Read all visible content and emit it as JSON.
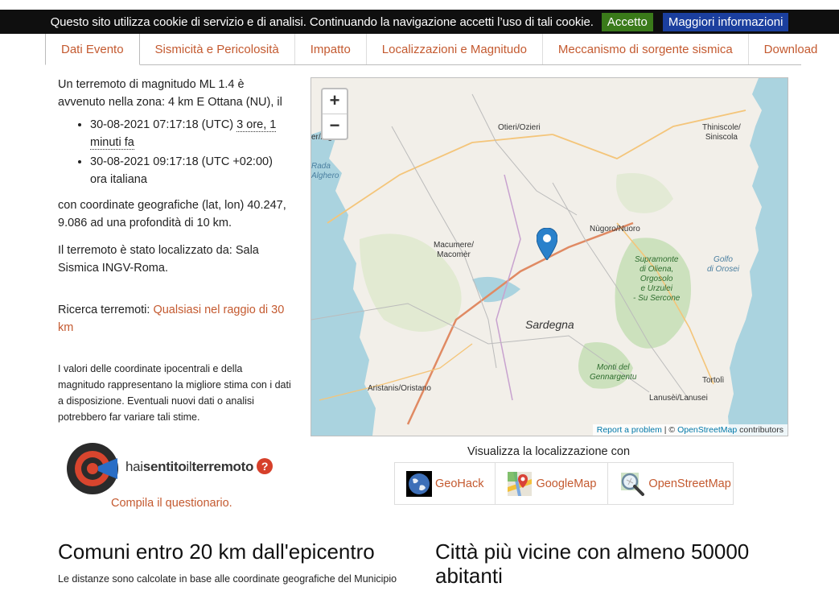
{
  "cookie": {
    "message": "Questo sito utilizza cookie di servizio e di analisi. Continuando la navigazione accetti l’uso di tali cookie.",
    "accept_label": "Accetto",
    "info_label": "Maggiori informazioni"
  },
  "tabs": [
    {
      "label": "Dati Evento"
    },
    {
      "label": "Sismicità e Pericolosità"
    },
    {
      "label": "Impatto"
    },
    {
      "label": "Localizzazioni e Magnitudo"
    },
    {
      "label": "Meccanismo di sorgente sismica"
    },
    {
      "label": "Download"
    }
  ],
  "event": {
    "intro": "Un terremoto di magnitudo ML 1.4 è avvenuto nella zona: 4 km E Ottana (NU), il",
    "utc_time": "30-08-2021 07:17:18 (UTC)",
    "ago": "3 ore, 1 minuti fa",
    "local_time": "30-08-2021 09:17:18 (UTC +02:00) ora italiana",
    "coords": "con coordinate geografiche (lat, lon) 40.247, 9.086 ad una profondità di 10 km.",
    "located_by": "Il terremoto è stato localizzato da: Sala Sismica INGV-Roma.",
    "search_label": "Ricerca terremoti:",
    "search_link": "Qualsiasi nel raggio di 30 km",
    "disclaimer": "I valori delle coordinate ipocentrali e della magnitudo rappresentano la migliore stima con i dati a disposizione. Eventuali nuovi dati o analisi potrebbero far variare tali stime."
  },
  "hst": {
    "text_prefix": "hai",
    "text_bold1": "sentito",
    "text_mid": "il",
    "text_bold2": "terremoto",
    "qmark": "?",
    "link": "Compila il questionario."
  },
  "map": {
    "zoom_in": "+",
    "zoom_out": "−",
    "attribution_report": "Report a problem",
    "attribution_sep": " | © ",
    "attribution_osm": "OpenStreetMap",
    "attribution_suffix": " contributors",
    "labels": {
      "otieri": "Otieri/Ozieri",
      "alghero": "er/Alghero",
      "rada": "Rada\nAlghero",
      "siniscola": "Thiniscole/\nSiniscola",
      "nuoro": "Nùgoro/Nuoro",
      "macomer": "Macumere/\nMacomèr",
      "supramonte": "Supramonte\ndi Oliena,\nOrgosolo\ne Urzulei\n- Su Sercone",
      "orosei": "Golfo\ndi Orosei",
      "sardegna": "Sardegna",
      "gennargentu": "Monti del\nGennargentu",
      "oristano": "Aristanis/Oristano",
      "tortoli": "Tortolì",
      "lanusei": "Lanusèi/Lanusei"
    },
    "accent_color": "#2a81cb"
  },
  "viz": {
    "title": "Visualizza la localizzazione con",
    "items": [
      {
        "label": "GeoHack",
        "icon": "globe-icon"
      },
      {
        "label": "GoogleMap",
        "icon": "googlemaps-icon"
      },
      {
        "label": "OpenStreetMap",
        "icon": "osm-magnifier-icon"
      }
    ]
  },
  "sections": {
    "comuni_title": "Comuni entro 20 km dall'epicentro",
    "comuni_note": "Le distanze sono calcolate in base alle coordinate geografiche del Municipio",
    "citta_title": "Città più vicine con almeno 50000 abitanti"
  },
  "colors": {
    "link": "#c45a30",
    "cookie_bg": "#0f0f0f",
    "accept_bg": "#3a7a1a",
    "info_bg": "#1b3f9e"
  }
}
